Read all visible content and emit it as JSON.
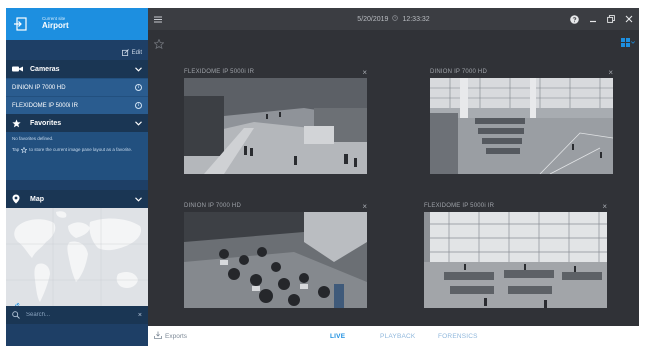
{
  "site": {
    "label": "Current site",
    "name": "Airport"
  },
  "sidebar": {
    "edit_label": "Edit",
    "cameras": {
      "title": "Cameras",
      "items": [
        {
          "name": "DINION IP 7000 HD"
        },
        {
          "name": "FLEXIDOME IP 5000i IR"
        }
      ]
    },
    "favorites": {
      "title": "Favorites",
      "empty_text": "No favorites defined.",
      "hint_prefix": "Tap",
      "hint_text": "to store the current image pane layout as a favorite."
    },
    "map": {
      "title": "Map",
      "here_label": "here"
    },
    "search": {
      "placeholder": "Search..."
    }
  },
  "topbar": {
    "date": "5/20/2019",
    "time": "12:33:32"
  },
  "tiles": [
    {
      "title": "FLEXIDOME IP 5000i IR"
    },
    {
      "title": "DINION IP 7000 HD"
    },
    {
      "title": "DINION IP 7000 HD"
    },
    {
      "title": "FLEXIDOME IP 5000i IR"
    }
  ],
  "bottombar": {
    "exports_label": "Exports",
    "tabs": {
      "live": "LIVE",
      "playback": "PLAYBACK",
      "forensics": "FORENSICS"
    }
  },
  "colors": {
    "accent": "#1d8fe0",
    "sidebar_bg": "#1e3f66",
    "main_bg": "#303237",
    "active_tab": "#1d8fe0"
  },
  "icons": {
    "site": "door-exit-icon",
    "edit": "edit-icon",
    "cameras": "camera-icon",
    "favorites": "star-icon",
    "map": "map-pin-icon",
    "search": "search-icon",
    "menu": "hamburger-icon",
    "help": "help-icon",
    "layout": "grid-layout-icon"
  }
}
